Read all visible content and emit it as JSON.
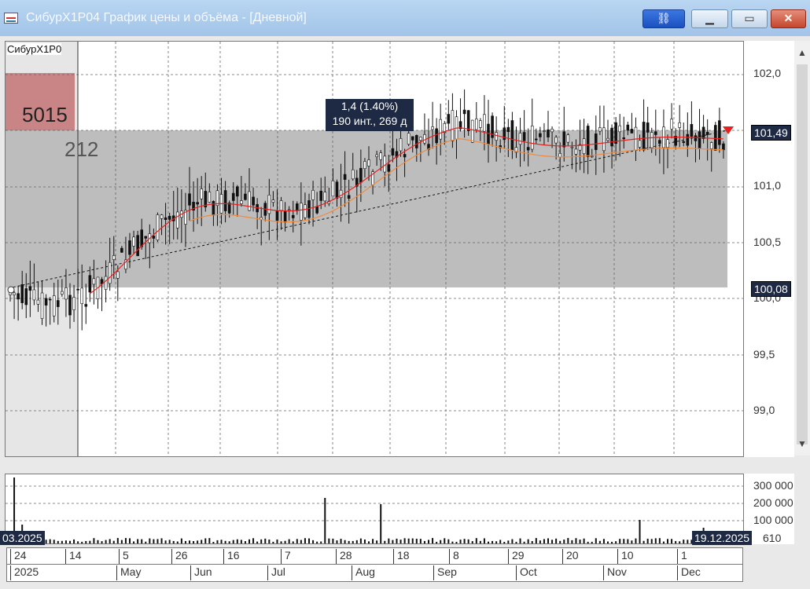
{
  "window": {
    "title": "СибурХ1Р04 График цены и объёма - [Дневной]",
    "link_icon": "link-icon",
    "minimize_icon": "minimize-icon",
    "maximize_icon": "maximize-icon",
    "close_icon": "close-icon"
  },
  "chart": {
    "ticker_label": "СибурХ1Р0",
    "order_book_bid": "5015",
    "order_book_ask": "212",
    "tooltip_line1": "1,4 (1.40%)",
    "tooltip_line2": "190 инт., 269 д",
    "price_ticks": [
      "102,0",
      "101,0",
      "100,5",
      "100,0",
      "99,5",
      "99,0"
    ],
    "last_price_tag": "101,49",
    "low_price_tag": "100,08",
    "volume_ticks": [
      "300 000",
      "200 000",
      "100 000"
    ],
    "volume_last": "610",
    "start_date_tag": "03.2025",
    "end_date_tag": "19.12.2025",
    "days": [
      "24",
      "14",
      "5",
      "26",
      "16",
      "7",
      "28",
      "18",
      "8",
      "29",
      "20",
      "10",
      "1"
    ],
    "months": [
      "2025",
      "May",
      "Jun",
      "Jul",
      "Aug",
      "Sep",
      "Oct",
      "Nov",
      "Dec"
    ],
    "colors": {
      "fast_ma": "#e8201e",
      "slow_ma": "#f08a3c",
      "trend": "#111111",
      "zone": "#bdbdbd",
      "candle": "#111111"
    }
  }
}
